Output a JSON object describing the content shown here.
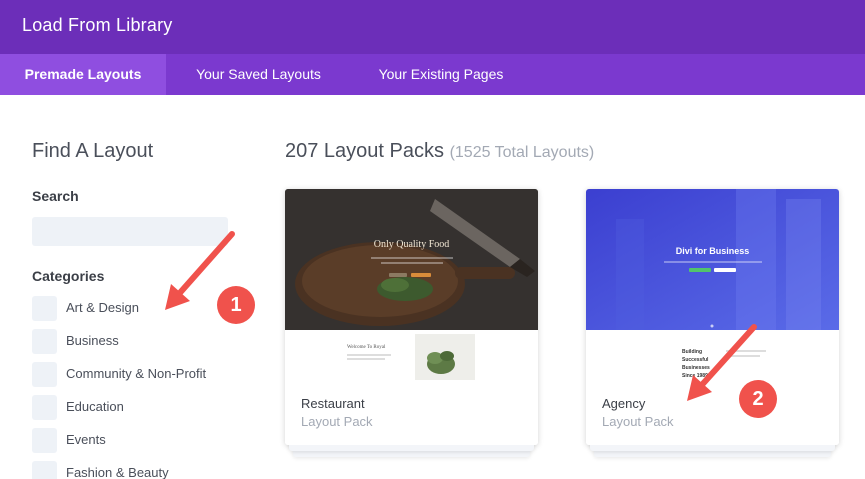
{
  "header": {
    "title": "Load From Library"
  },
  "tabs": [
    {
      "label": "Premade Layouts",
      "active": true
    },
    {
      "label": "Your Saved Layouts",
      "active": false
    },
    {
      "label": "Your Existing Pages",
      "active": false
    }
  ],
  "sidebar": {
    "title": "Find A Layout",
    "search_label": "Search",
    "search_value": "",
    "categories_label": "Categories",
    "categories": [
      "Art & Design",
      "Business",
      "Community & Non-Profit",
      "Education",
      "Events",
      "Fashion & Beauty"
    ]
  },
  "main": {
    "title": "207 Layout Packs",
    "total": "(1525 Total Layouts)",
    "cards": [
      {
        "name": "Restaurant",
        "subtitle": "Layout Pack",
        "preview_heading": "Only Quality Food",
        "preview_section": "Welcome To Royal"
      },
      {
        "name": "Agency",
        "subtitle": "Layout Pack",
        "preview_heading": "Divi for Business",
        "preview_section": "Building Successful Businesses Since 1989"
      }
    ]
  },
  "annotations": [
    {
      "number": "1"
    },
    {
      "number": "2"
    }
  ],
  "colors": {
    "header": "#6c2eb9",
    "tabbar": "#7b39cf",
    "active_tab": "#8f4ee0",
    "badge": "#f0524c"
  }
}
